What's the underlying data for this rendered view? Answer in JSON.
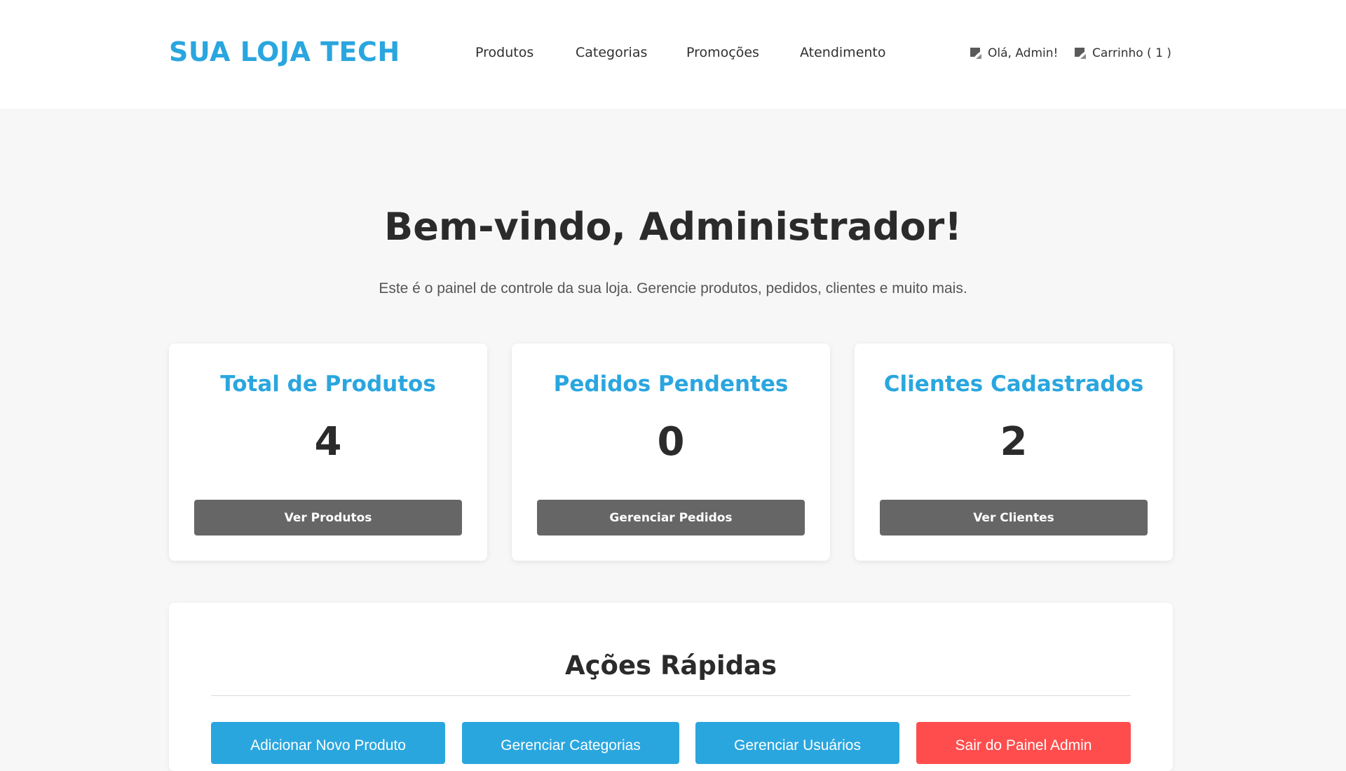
{
  "header": {
    "logo": "SUA LOJA TECH",
    "nav": [
      "Produtos",
      "Categorias",
      "Promoções",
      "Atendimento"
    ],
    "user_greeting": "Olá, Admin!",
    "cart_label": "Carrinho ( 1 )"
  },
  "hero": {
    "title": "Bem-vindo, Administrador!",
    "subtitle": "Este é o painel de controle da sua loja. Gerencie produtos, pedidos, clientes e muito mais."
  },
  "cards": [
    {
      "title": "Total de Produtos",
      "value": "4",
      "button": "Ver Produtos"
    },
    {
      "title": "Pedidos Pendentes",
      "value": "0",
      "button": "Gerenciar Pedidos"
    },
    {
      "title": "Clientes Cadastrados",
      "value": "2",
      "button": "Ver Clientes"
    }
  ],
  "quick_actions": {
    "title": "Ações Rápidas",
    "buttons": [
      {
        "label": "Adicionar Novo Produto",
        "color": "#2aa6df"
      },
      {
        "label": "Gerenciar Categorias",
        "color": "#2aa6df"
      },
      {
        "label": "Gerenciar Usuários",
        "color": "#2aa6df"
      },
      {
        "label": "Sair do Painel Admin",
        "color": "#ff4d4d"
      }
    ]
  },
  "colors": {
    "accent": "#2aa6df",
    "danger": "#ff4d4d",
    "card_button": "#666666",
    "background": "#f7f7f7"
  },
  "icons": {
    "user": "broken-image-icon",
    "cart": "broken-image-icon"
  }
}
